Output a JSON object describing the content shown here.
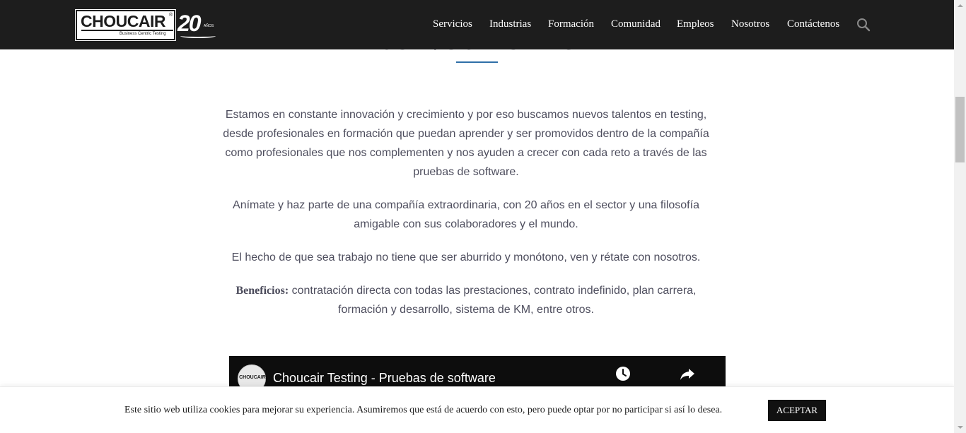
{
  "header": {
    "logo": {
      "brand": "CHOUCAIR",
      "tagline": "Business Centric Testing",
      "anniversary": "20",
      "anniversary_sub": "AÑOS"
    },
    "nav": [
      {
        "label": "Servicios"
      },
      {
        "label": "Industrias"
      },
      {
        "label": "Formación"
      },
      {
        "label": "Comunidad"
      },
      {
        "label": "Empleos"
      },
      {
        "label": "Nosotros"
      },
      {
        "label": "Contáctenos"
      }
    ],
    "search_icon": "search-icon"
  },
  "main": {
    "heading": "CONVOCATORIAS",
    "paragraphs": [
      "Estamos en constante innovación y crecimiento y por eso buscamos nuevos talentos en testing, desde profesionales en formación que puedan aprender y ser promovidos dentro de la compañía como profesionales que nos complementen y nos ayuden a crecer con cada reto a través de las pruebas de software.",
      "Anímate y haz parte de una compañía extraordinaria, con 20 años en el sector y una filosofía amigable con sus colaboradores y el mundo.",
      "El hecho de que sea trabajo no tiene que ser aburrido y monótono, ven y rétate con nosotros."
    ],
    "benefits": {
      "label": "Beneficios:",
      "text": " contratación directa con todas las prestaciones, contrato indefinido,  plan carrera, formación y desarrollo, sistema de KM, entre otros."
    },
    "video": {
      "channel_avatar_text": "CHOUCAIR",
      "title": "Choucair Testing - Pruebas de software",
      "watch_later_icon": "clock-icon",
      "share_icon": "share-icon"
    }
  },
  "cookie_bar": {
    "text": "Este sitio web utiliza cookies para mejorar su experiencia. Asumiremos que está de acuerdo con esto, pero puede optar por no participar si así lo desea.",
    "accept_label": "ACEPTAR"
  },
  "colors": {
    "header_bg": "#1d1d1d",
    "accent_rule": "#2f6fa8",
    "body_text": "#4e4e5e",
    "button_bg": "#111111"
  }
}
